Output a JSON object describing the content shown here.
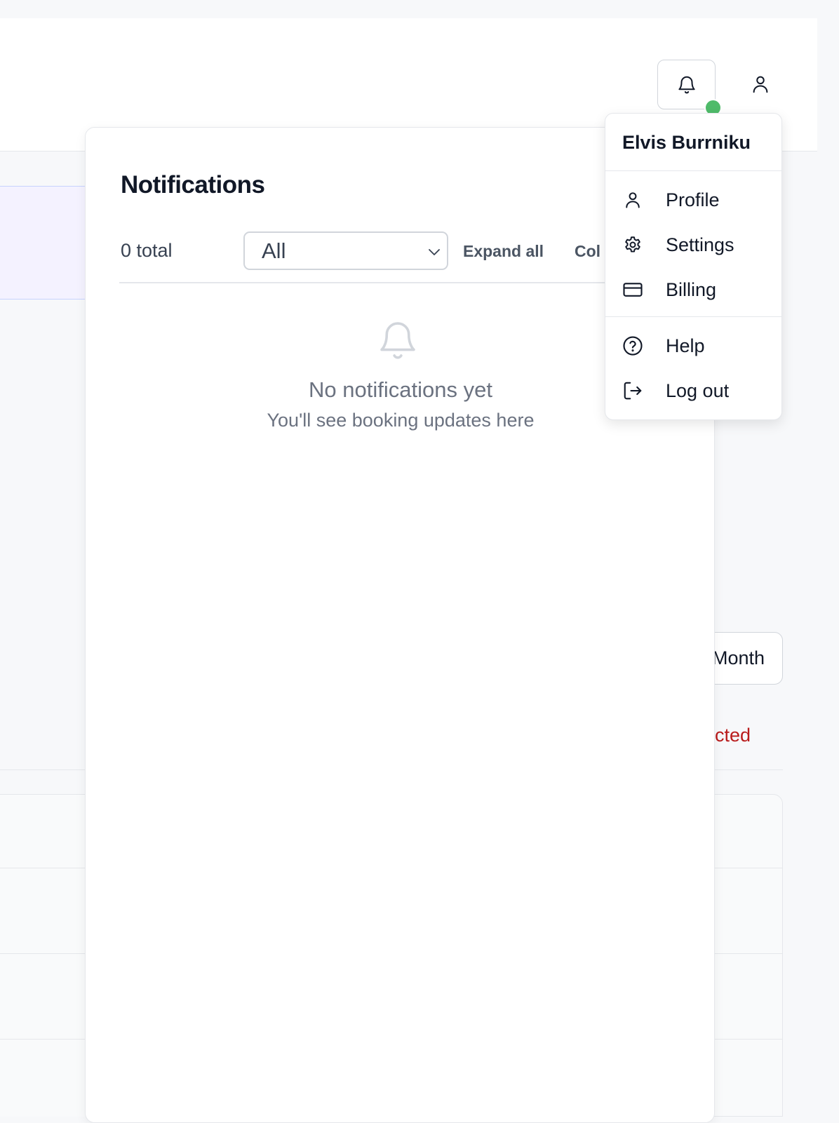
{
  "header": {
    "notifications_icon": "bell-icon",
    "user_icon": "user-icon",
    "status_color": "#4fbb6a"
  },
  "background": {
    "month_label": "Month",
    "rejected_label": "cted"
  },
  "notifications": {
    "title": "Notifications",
    "total": "0 total",
    "filter_value": "All",
    "expand_all": "Expand all",
    "collapse_all": "Col",
    "empty_title": "No notifications yet",
    "empty_subtitle": "You'll see booking updates here"
  },
  "user_menu": {
    "name": "Elvis Burrniku",
    "items": [
      {
        "label": "Profile",
        "icon": "user-icon"
      },
      {
        "label": "Settings",
        "icon": "gear-icon"
      },
      {
        "label": "Billing",
        "icon": "credit-card-icon"
      },
      {
        "label": "Help",
        "icon": "help-circle-icon"
      },
      {
        "label": "Log out",
        "icon": "logout-icon"
      }
    ]
  }
}
